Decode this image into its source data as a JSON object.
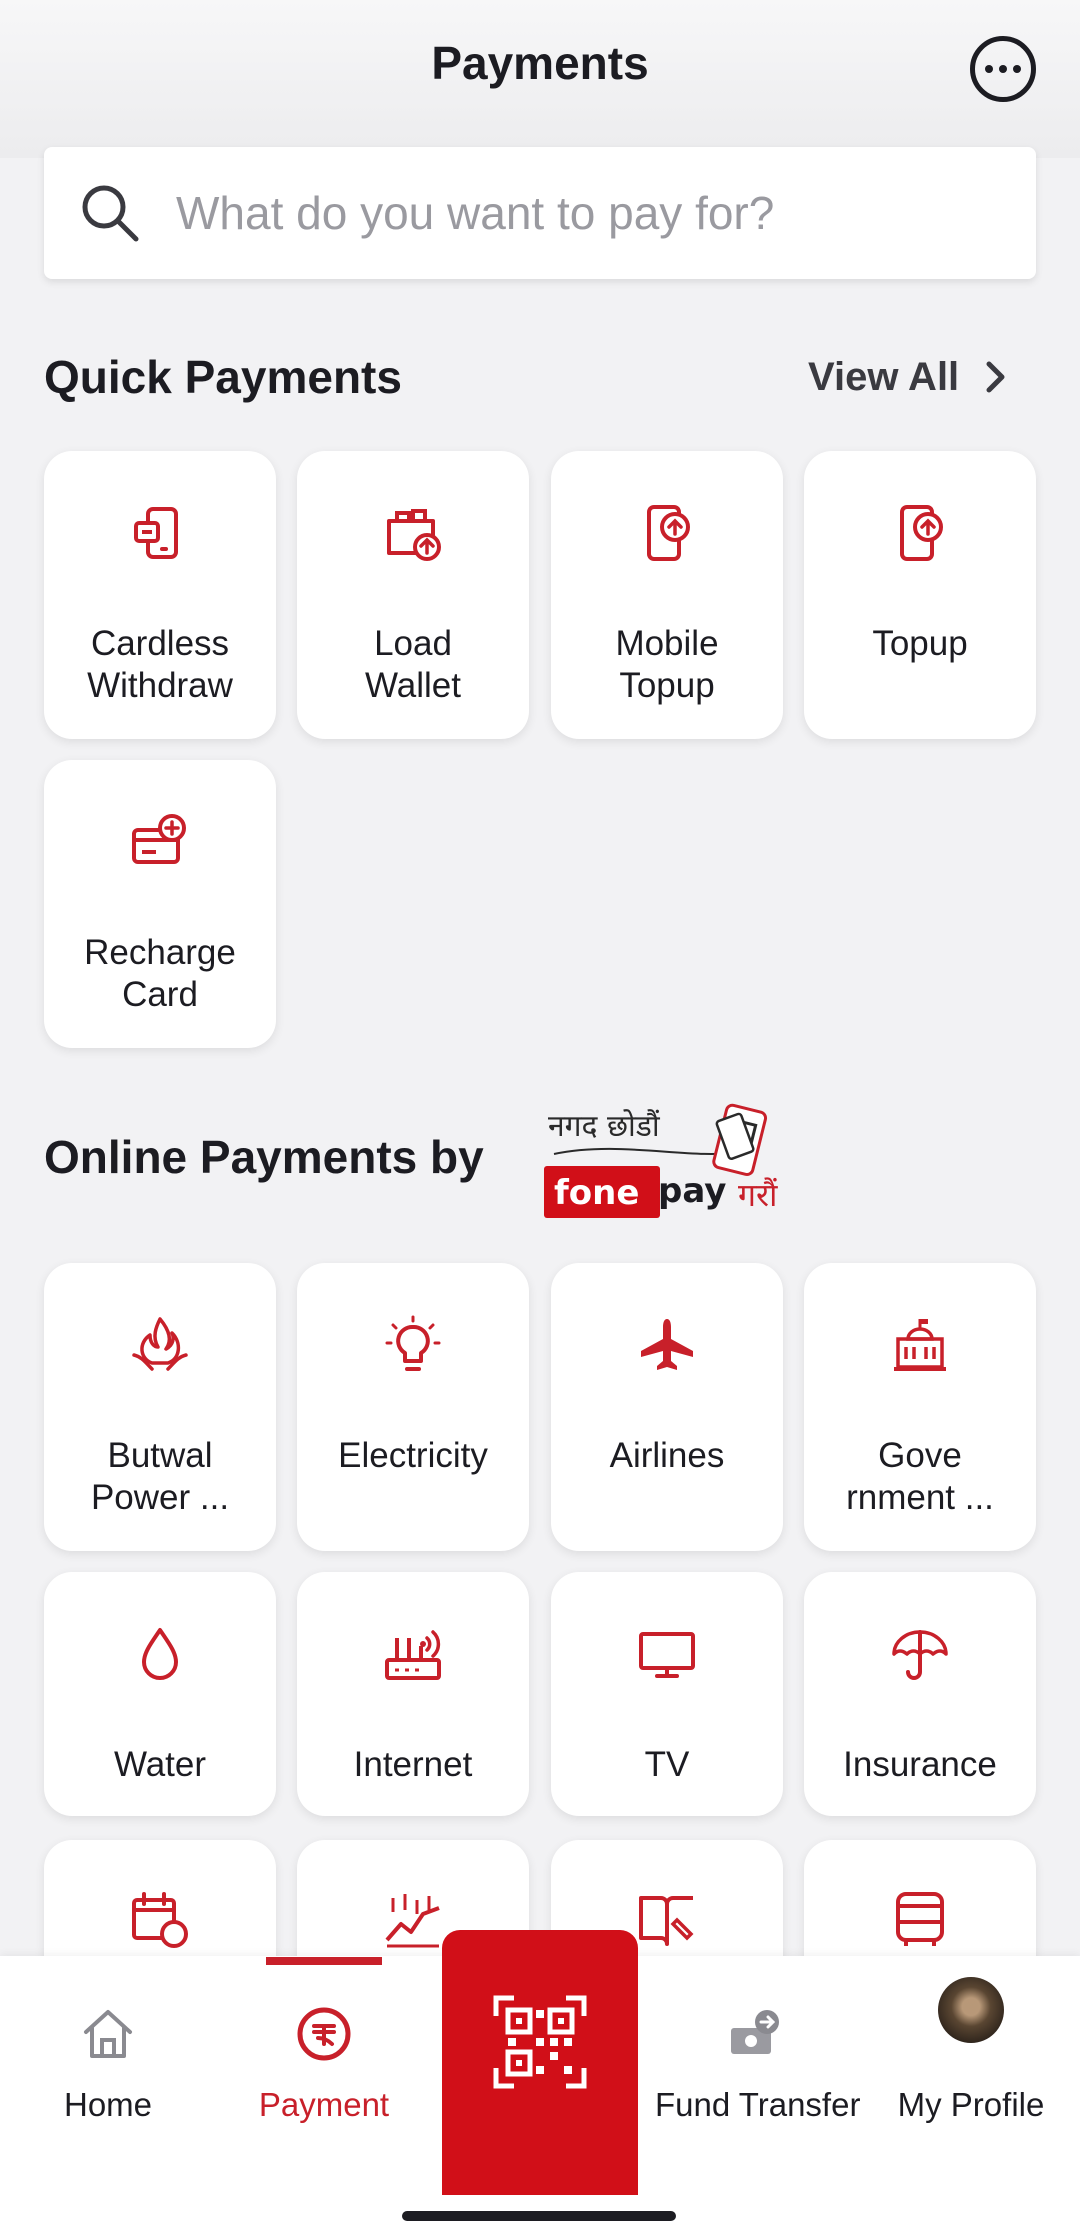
{
  "header": {
    "title": "Payments",
    "more_icon": "more-horizontal-icon"
  },
  "search": {
    "placeholder": "What do you want to pay for?",
    "value": "",
    "icon": "search-icon"
  },
  "quick_payments": {
    "title": "Quick Payments",
    "view_all": "View All",
    "items": [
      {
        "label": "Cardless Withdraw",
        "icon": "cardless-withdraw-icon"
      },
      {
        "label": "Load Wallet",
        "icon": "load-wallet-icon"
      },
      {
        "label": "Mobile Topup",
        "icon": "mobile-topup-icon"
      },
      {
        "label": "Topup",
        "icon": "topup-icon"
      },
      {
        "label": "Recharge Card",
        "icon": "recharge-card-icon"
      }
    ]
  },
  "online_payments": {
    "title": "Online Payments by",
    "logo": {
      "tagline": "नगद छोडौं",
      "brand_fone": "fone",
      "brand_pay": "pay",
      "suffix": "गरौं"
    },
    "items": [
      {
        "label": "Butwal Power ...",
        "icon": "power-flame-icon"
      },
      {
        "label": "Electricity",
        "icon": "lightbulb-icon"
      },
      {
        "label": "Airlines",
        "icon": "airplane-icon"
      },
      {
        "label": "Gove rnment ...",
        "icon": "government-building-icon"
      },
      {
        "label": "Water",
        "icon": "water-drop-icon"
      },
      {
        "label": "Internet",
        "icon": "router-icon"
      },
      {
        "label": "TV",
        "icon": "tv-icon"
      },
      {
        "label": "Insurance",
        "icon": "umbrella-icon"
      },
      {
        "label": "",
        "icon": "calendar-payment-icon"
      },
      {
        "label": "",
        "icon": "stock-chart-icon"
      },
      {
        "label": "",
        "icon": "book-pen-icon"
      },
      {
        "label": "",
        "icon": "bus-icon"
      }
    ]
  },
  "bottom_nav": {
    "items": [
      {
        "label": "Home",
        "icon": "home-icon"
      },
      {
        "label": "Payment",
        "icon": "payment-icon"
      },
      {
        "label": "Fund Transfer",
        "icon": "fund-transfer-icon"
      },
      {
        "label": "My Profile",
        "icon": "avatar"
      }
    ],
    "active": "Payment",
    "center_icon": "qr-code-icon"
  },
  "colors": {
    "accent": "#C8202A",
    "qr_button": "#D10F18",
    "background": "#F2F2F4"
  }
}
